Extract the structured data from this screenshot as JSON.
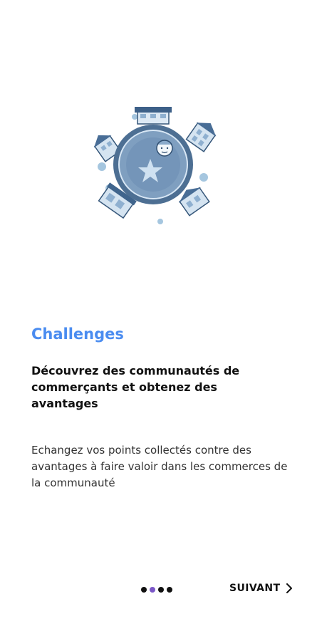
{
  "onboarding": {
    "title": "Challenges",
    "subtitle": "Découvrez des communautés de commerçants et obtenez des avantages",
    "description": "Echangez vos points collectés contre des avantages à faire valoir dans les commerces de la communauté",
    "next_label": "SUIVANT",
    "page_indicator": {
      "total": 4,
      "active_index": 1
    }
  },
  "colors": {
    "title": "#4a8cf0",
    "active_dot": "#7b57c7",
    "text": "#111111",
    "globe": "#5f86b0"
  },
  "icons": {
    "illustration": "community-globe-illustration",
    "next": "chevron-right-icon"
  }
}
